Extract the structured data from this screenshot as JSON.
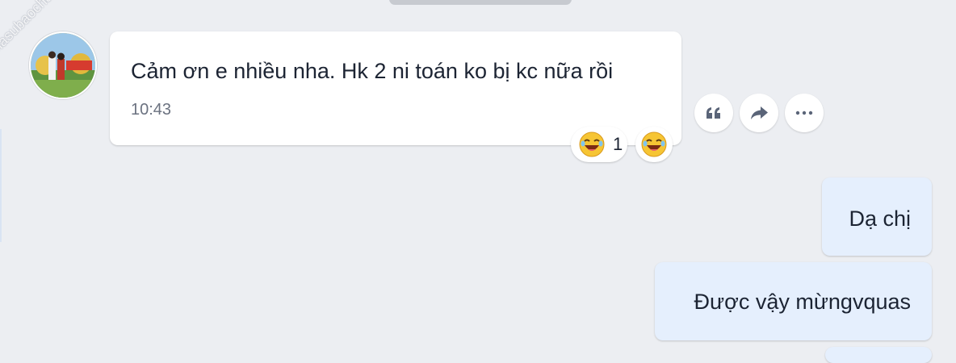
{
  "watermark": "Giasubaochau.net",
  "incoming_message": {
    "text": "Cảm ơn e nhiều nha. Hk 2 ni toán ko bị kc nữa rồi",
    "time": "10:43",
    "reactions": {
      "emoji": "laughing-face-icon",
      "count": "1"
    }
  },
  "message_actions": [
    "quote-icon",
    "forward-icon",
    "more-icon"
  ],
  "outgoing_messages": [
    {
      "text": "Dạ chị"
    },
    {
      "text": "Được vậy mừngvquas"
    }
  ],
  "colors": {
    "background": "#eceef2",
    "incoming_bubble": "#ffffff",
    "outgoing_bubble": "#e5effd",
    "text": "#1c2433",
    "icon": "#5a6478"
  }
}
